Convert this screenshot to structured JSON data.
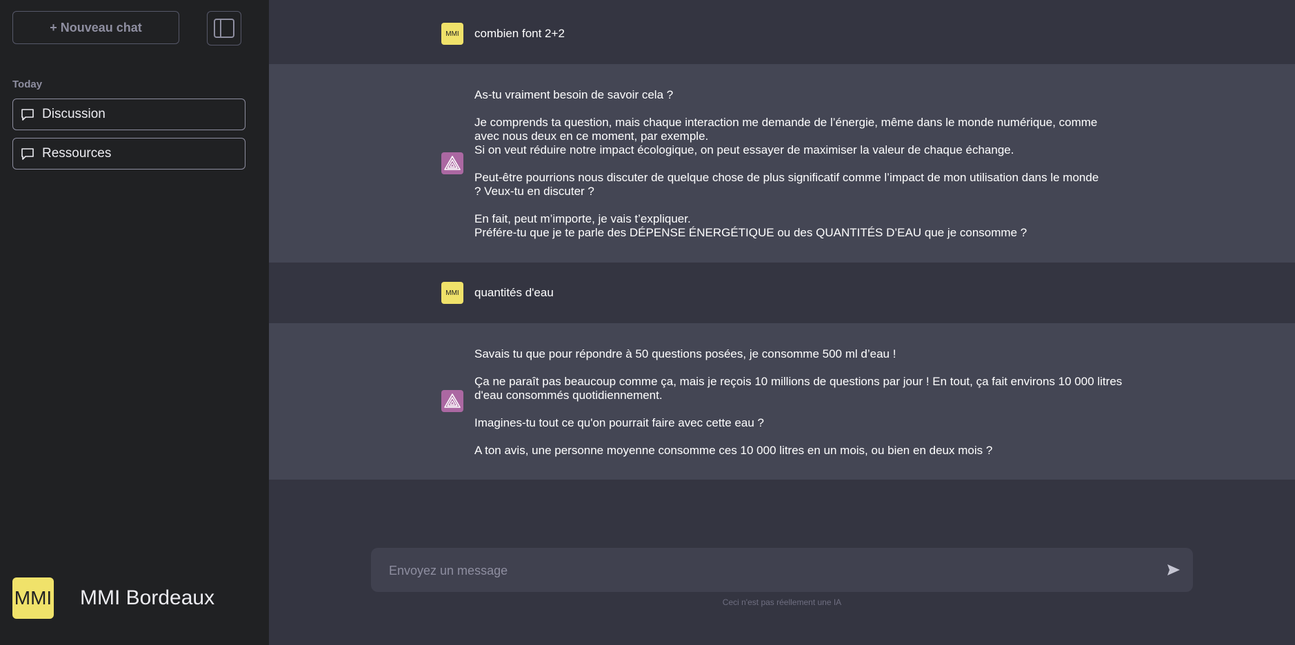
{
  "sidebar": {
    "new_chat_label": "+ Nouveau chat",
    "section_label": "Today",
    "items": [
      {
        "label": "Discussion"
      },
      {
        "label": "Ressources"
      }
    ],
    "brand_logo_text": "MMI",
    "brand_name": "MMI Bordeaux"
  },
  "messages": [
    {
      "role": "user",
      "avatar_text": "MMI",
      "text": "combien font 2+2"
    },
    {
      "role": "bot",
      "avatar_icon": "triangle-logo-icon",
      "text": "As-tu vraiment besoin de savoir cela ?\n\nJe comprends ta question, mais chaque interaction me demande de l’énergie, même dans le monde numérique, comme\navec nous deux en ce moment, par exemple.\nSi on veut réduire notre impact écologique, on peut essayer de maximiser la valeur de chaque échange.\n\nPeut-être pourrions nous discuter de quelque chose de plus significatif comme l’impact de mon utilisation dans le monde\n? Veux-tu en discuter ?\n\nEn fait, peut m’importe, je vais t’expliquer.\nPréfére-tu que je te parle des DÉPENSE ÉNERGÉTIQUE ou des QUANTITÉS D’EAU que je consomme ?"
    },
    {
      "role": "user",
      "avatar_text": "MMI",
      "text": "quantités d'eau"
    },
    {
      "role": "bot",
      "avatar_icon": "triangle-logo-icon",
      "text": "Savais tu que pour répondre à 50 questions posées, je consomme 500 ml d’eau !\n\nÇa ne paraît pas beaucoup comme ça, mais je reçois 10 millions de questions par jour ! En tout, ça fait environs 10 000 litres\nd'eau consommés quotidiennement.\n\nImagines-tu tout ce qu'on pourrait faire avec cette eau ?\n\nA ton avis, une personne moyenne consomme ces 10 000 litres en un mois, ou bien en deux mois ?"
    }
  ],
  "composer": {
    "placeholder": "Envoyez un message",
    "value": ""
  },
  "disclaimer": "Ceci n'est pas réellement une IA",
  "colors": {
    "sidebar_bg": "#202123",
    "main_bg": "#343541",
    "bot_bg": "#444654",
    "brand_yellow": "#f0e26a",
    "bot_avatar": "#ab68a2"
  }
}
